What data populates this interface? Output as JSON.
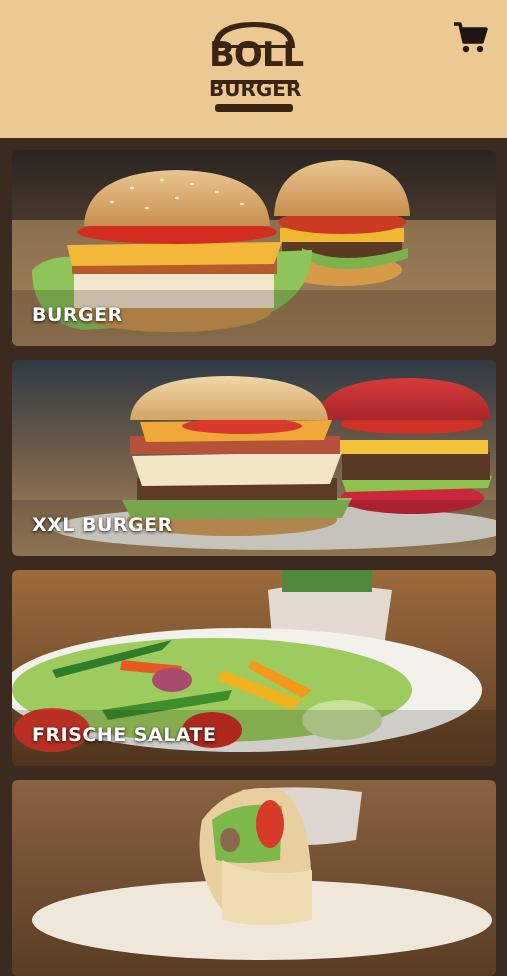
{
  "header": {
    "logo_line1": "BOLL",
    "logo_line2": "BURGER",
    "cart_icon": "shopping-cart-icon"
  },
  "categories": [
    {
      "label": "BURGER"
    },
    {
      "label": "XXL BURGER"
    },
    {
      "label": "FRISCHE SALATE"
    },
    {
      "label": ""
    }
  ],
  "colors": {
    "header_bg": "#ecc992",
    "page_bg": "#3b2a20",
    "logo_brown": "#3b2414"
  }
}
